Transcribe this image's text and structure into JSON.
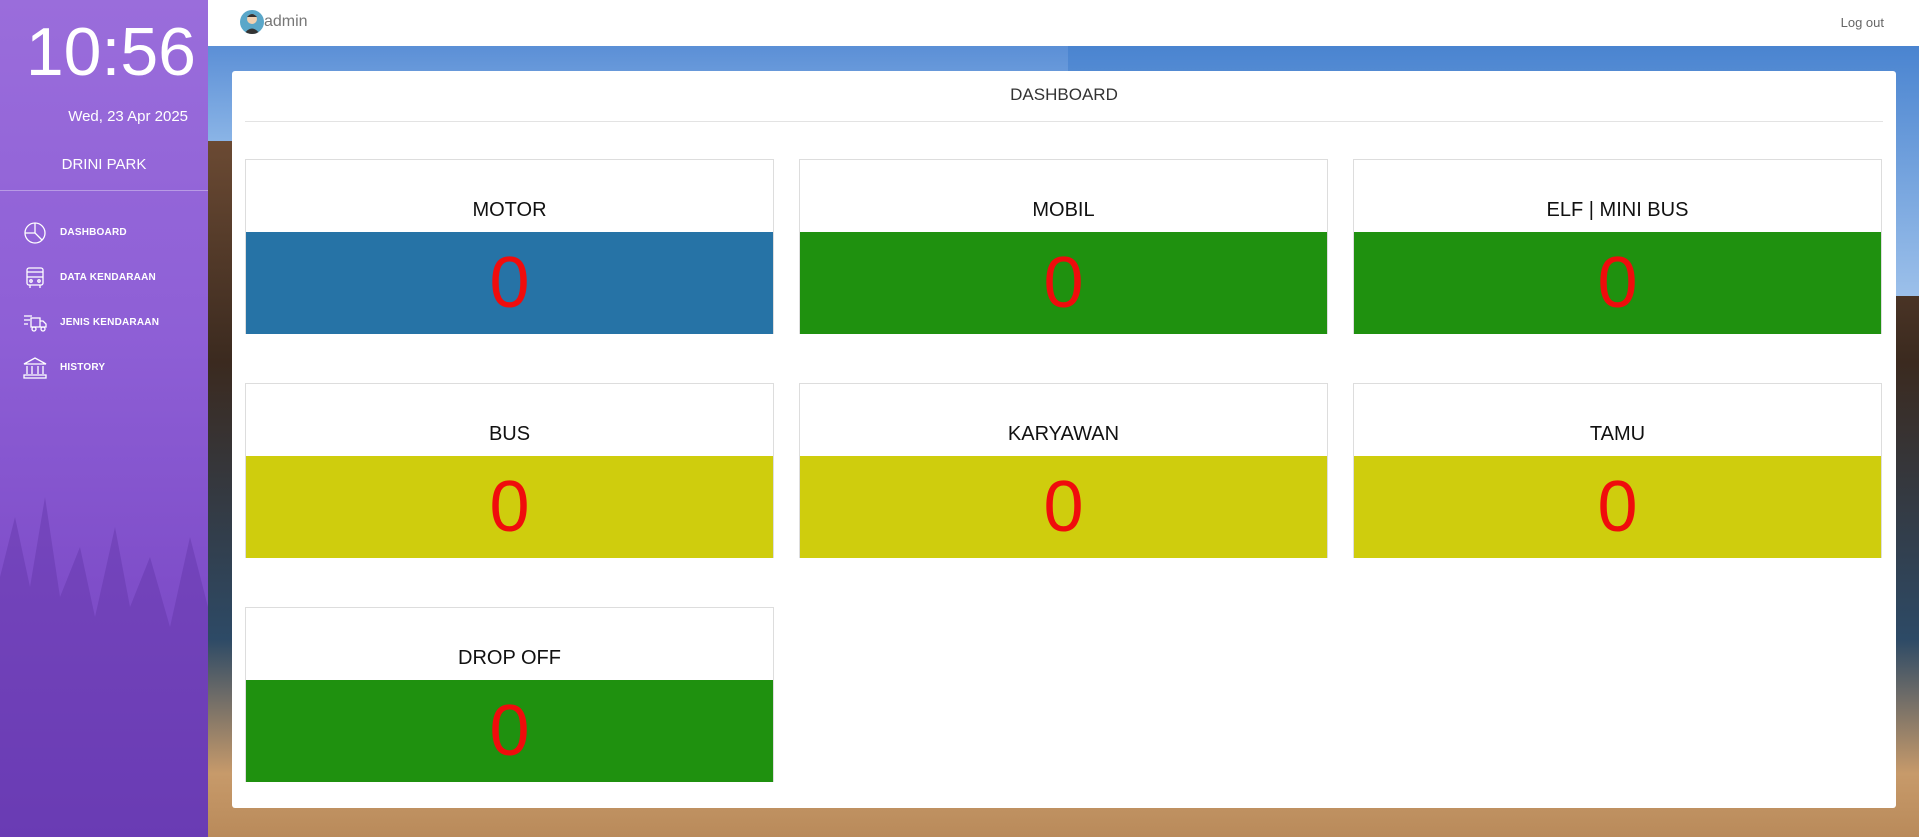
{
  "sidebar": {
    "clock": "10:56",
    "date": "Wed, 23 Apr 2025",
    "site_name": "DRINI PARK",
    "items": [
      {
        "label": "DASHBOARD",
        "icon": "pie-chart-icon"
      },
      {
        "label": "DATA KENDARAAN",
        "icon": "bus-icon"
      },
      {
        "label": "JENIS KENDARAAN",
        "icon": "delivery-truck-icon"
      },
      {
        "label": "HISTORY",
        "icon": "bank-icon"
      }
    ]
  },
  "topbar": {
    "username": "admin",
    "logout_label": "Log out"
  },
  "dashboard": {
    "title": "DASHBOARD",
    "tiles": [
      {
        "name": "MOTOR",
        "value": "0",
        "color": "#2673a6"
      },
      {
        "name": "MOBIL",
        "value": "0",
        "color": "#1f910f"
      },
      {
        "name": "ELF | MINI BUS",
        "value": "0",
        "color": "#1f910f"
      },
      {
        "name": "BUS",
        "value": "0",
        "color": "#cfcd0d"
      },
      {
        "name": "KARYAWAN",
        "value": "0",
        "color": "#cfcd0d"
      },
      {
        "name": "TAMU",
        "value": "0",
        "color": "#cfcd0d"
      },
      {
        "name": "DROP OFF",
        "value": "0",
        "color": "#1f910f"
      }
    ]
  },
  "colors": {
    "value_text": "#f00c0c",
    "sidebar_accent": "#8e5fd6"
  }
}
